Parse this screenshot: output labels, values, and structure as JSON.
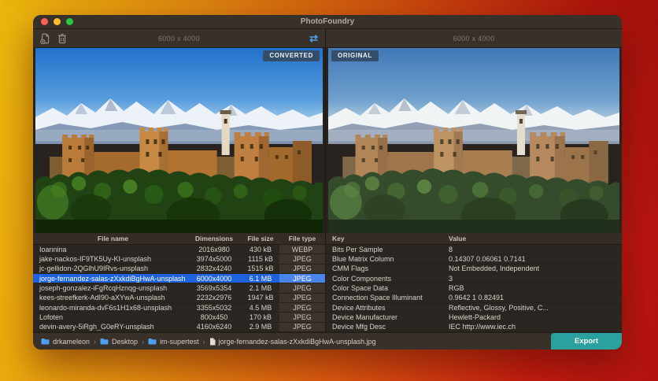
{
  "app": {
    "title": "PhotoFoundry"
  },
  "toolbar": {
    "add_file_icon": "add-file",
    "trash_icon": "trash",
    "swap_icon": "swap-compare"
  },
  "left_pane": {
    "dimensions_label": "6000 x 4000",
    "badge": "CONVERTED"
  },
  "right_pane": {
    "dimensions_label": "6000 x 4000",
    "badge": "ORIGINAL"
  },
  "file_table": {
    "columns": [
      "File name",
      "Dimensions",
      "File size",
      "File type"
    ],
    "rows": [
      {
        "name": "Ioannina",
        "dimensions": "2016x980",
        "size": "430 kB",
        "type": "WEBP",
        "selected": false
      },
      {
        "name": "jake-nackos-IF9TK5Uy-KI-unsplash",
        "dimensions": "3974x5000",
        "size": "1115 kB",
        "type": "JPEG",
        "selected": false
      },
      {
        "name": "jc-gellidon-2QGlhU9IRvs-unsplash",
        "dimensions": "2832x4240",
        "size": "1515 kB",
        "type": "JPEG",
        "selected": false
      },
      {
        "name": "jorge-fernandez-salas-zXxkdiBgHwA-unsplash",
        "dimensions": "6000x4000",
        "size": "6.1 MB",
        "type": "JPEG",
        "selected": true
      },
      {
        "name": "joseph-gonzalez-iFgRcqHznqg-unsplash",
        "dimensions": "3569x5354",
        "size": "2.1 MB",
        "type": "JPEG",
        "selected": false
      },
      {
        "name": "kees-streefkerk-AdI90-aXYwA-unsplash",
        "dimensions": "2232x2976",
        "size": "1947 kB",
        "type": "JPEG",
        "selected": false
      },
      {
        "name": "leonardo-miranda-dvF6s1H1x68-unsplash",
        "dimensions": "3355x5032",
        "size": "4.5 MB",
        "type": "JPEG",
        "selected": false
      },
      {
        "name": "Lofoten",
        "dimensions": "800x450",
        "size": "170 kB",
        "type": "JPEG",
        "selected": false
      },
      {
        "name": "devin-avery-5iRgh_G0eRY-unsplash",
        "dimensions": "4160x6240",
        "size": "2.9 MB",
        "type": "JPEG",
        "selected": false
      }
    ]
  },
  "metadata_table": {
    "columns": [
      "Key",
      "Value"
    ],
    "rows": [
      {
        "key": "Bits Per Sample",
        "value": "8"
      },
      {
        "key": "Blue Matrix Column",
        "value": "0.14307 0.06061 0.7141"
      },
      {
        "key": "CMM Flags",
        "value": "Not Embedded, Independent"
      },
      {
        "key": "Color Components",
        "value": "3"
      },
      {
        "key": "Color Space Data",
        "value": "RGB"
      },
      {
        "key": "Connection Space Illuminant",
        "value": "0.9642 1 0.82491"
      },
      {
        "key": "Device Attributes",
        "value": "Reflective, Glossy, Positive, C..."
      },
      {
        "key": "Device Manufacturer",
        "value": "Hewlett-Packard"
      },
      {
        "key": "Device Mfg Desc",
        "value": "IEC http://www.iec.ch"
      }
    ]
  },
  "breadcrumb": {
    "separator": "›",
    "items": [
      {
        "label": "drkameleon",
        "icon": "folder"
      },
      {
        "label": "Desktop",
        "icon": "folder"
      },
      {
        "label": "im-supertest",
        "icon": "folder"
      },
      {
        "label": "jorge-fernandez-salas-zXxkdiBgHwA-unsplash.jpg",
        "icon": "file"
      }
    ]
  },
  "export_button": {
    "label": "Export"
  },
  "colors": {
    "selection_blue": "#1e63de",
    "export_teal": "#2ba19f",
    "folder_blue": "#4e9ef0",
    "badge_bg": "#344a62",
    "traffic_red": "#ff5f57",
    "traffic_yellow": "#febc2e",
    "traffic_green": "#28c840"
  }
}
